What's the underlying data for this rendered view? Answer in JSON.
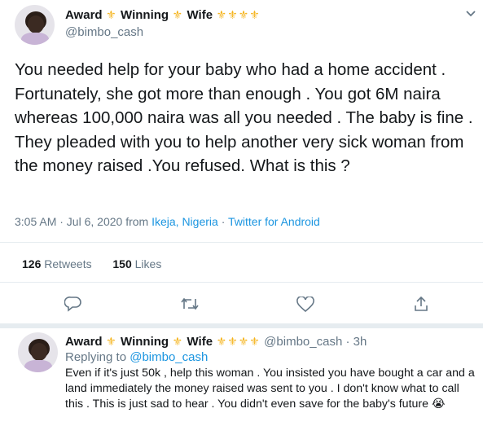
{
  "main_tweet": {
    "name_parts": [
      "Award",
      "Winning",
      "Wife"
    ],
    "handle": "@bimbo_cash",
    "text": "You needed help for your baby who had a home accident . Fortunately, she got more than enough . You got 6M naira whereas 100,000 naira was all you needed . The baby is fine . They pleaded with you to help another very sick woman from the money raised .You refused.  What is this ?",
    "time": "3:05 AM · Jul 6, 2020 from",
    "location": "Ikeja, Nigeria",
    "separator": "·",
    "client": "Twitter for Android",
    "retweets_count": "126",
    "retweets_label": "Retweets",
    "likes_count": "150",
    "likes_label": "Likes"
  },
  "reply": {
    "name_parts": [
      "Award",
      "Winning",
      "Wife"
    ],
    "handle_time": "@bimbo_cash · 3h",
    "replying_prefix": "Replying to",
    "replying_handle": "@bimbo_cash",
    "text": "Even if it's just 50k , help this woman . You insisted you have bought a car and a land immediately the money raised was sent to you . I don't know what to call this . This is just sad to hear . You didn't even save for the baby's future 😭"
  },
  "icons": {
    "crown": "crown-icon",
    "chevron": "chevron-down-icon",
    "reply": "reply-icon",
    "retweet": "retweet-icon",
    "like": "heart-icon",
    "share": "share-icon"
  },
  "colors": {
    "link": "#1b95e0",
    "muted": "#657786",
    "crown": "#f5b31a",
    "divider": "#e6ecf0"
  }
}
